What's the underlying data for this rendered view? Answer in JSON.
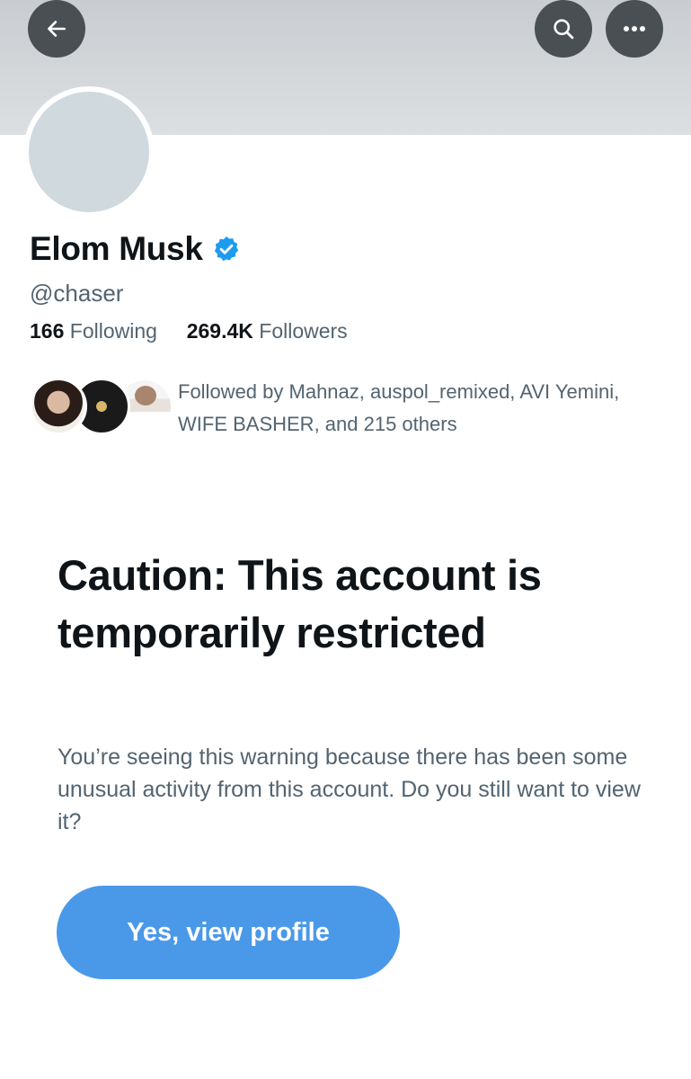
{
  "header": {
    "back_icon": "arrow-left-icon",
    "search_icon": "search-icon",
    "more_icon": "more-horizontal-icon",
    "banner_color": "#d4d7da"
  },
  "profile": {
    "display_name": "Elom Musk",
    "verified_icon": "verified-badge-icon",
    "verified_color": "#1d9bf0",
    "handle": "@chaser",
    "following_count": "166",
    "following_label": "Following",
    "followers_count": "269.4K",
    "followers_label": "Followers",
    "followed_by_text": "Followed by Mahnaz, auspol_remixed, AVI Yemini, WIFE BASHER, and 215 others"
  },
  "warning": {
    "title": "Caution: This account is temporarily restricted",
    "body": "You’re seeing this warning because there has been some unusual activity from this account. Do you still want to view it?",
    "button_label": "Yes, view profile",
    "button_color": "#4a99e9"
  }
}
